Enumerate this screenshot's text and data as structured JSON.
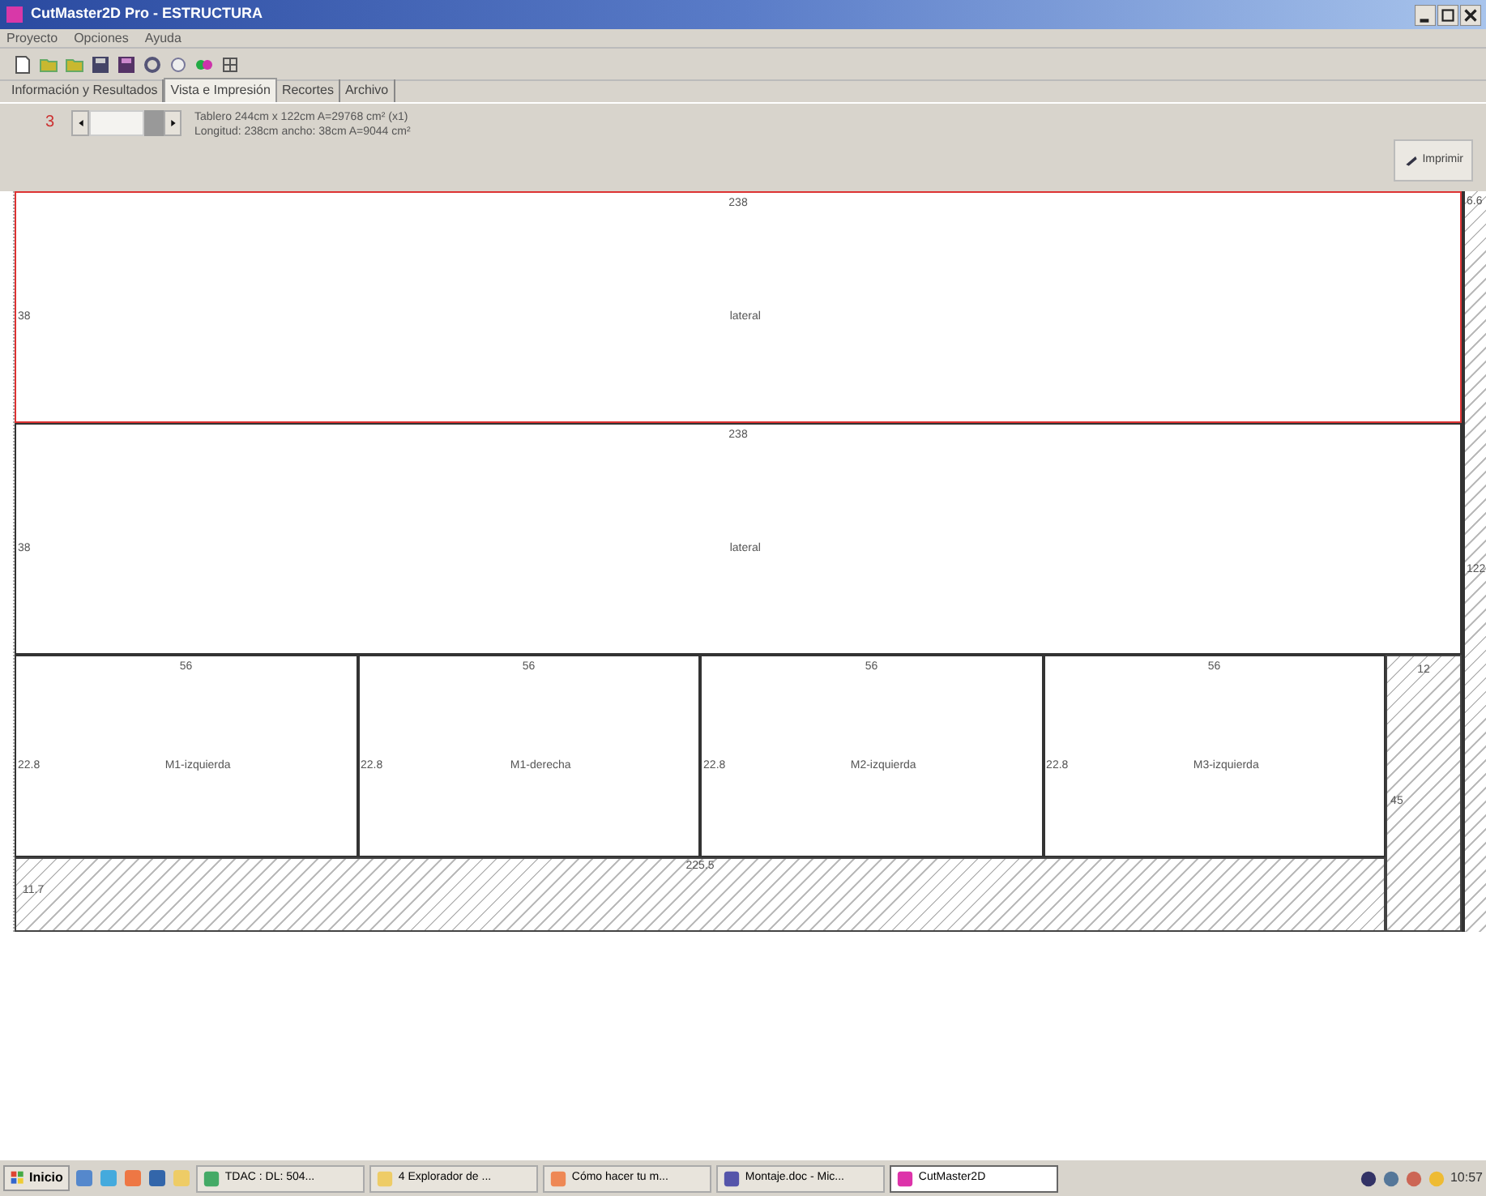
{
  "window": {
    "title": "CutMaster2D Pro - ESTRUCTURA"
  },
  "menu": [
    "Proyecto",
    "Opciones",
    "Ayuda"
  ],
  "tabs": [
    {
      "label": "Información y Resultados",
      "selected": false
    },
    {
      "label": "Vista e Impresión",
      "selected": true
    },
    {
      "label": "Recortes",
      "selected": false
    },
    {
      "label": "Archivo",
      "selected": false
    }
  ],
  "viewer": {
    "page": "3",
    "board_info": "Tablero 244cm x 122cm A=29768 cm² (x1)",
    "piece_info": "Longitud: 238cm ancho: 38cm A=9044 cm²",
    "print_button": "Imprimir"
  },
  "layout": {
    "rows": [
      {
        "pieces": [
          {
            "width_label": "238",
            "height_label": "38",
            "name": "lateral",
            "selected": true
          }
        ]
      },
      {
        "pieces": [
          {
            "width_label": "238",
            "height_label": "38",
            "name": "lateral",
            "selected": false
          }
        ]
      },
      {
        "pieces": [
          {
            "width_label": "56",
            "height_label": "22.8",
            "name": "M1-izquierda",
            "selected": false
          },
          {
            "width_label": "56",
            "height_label": "22.8",
            "name": "M1-derecha",
            "selected": false
          },
          {
            "width_label": "56",
            "height_label": "22.8",
            "name": "M2-izquierda",
            "selected": false
          },
          {
            "width_label": "56",
            "height_label": "22.8",
            "name": "M3-izquierda",
            "selected": false
          }
        ]
      }
    ],
    "bottom_waste": {
      "width_label": "225.5",
      "height_label": "11.7"
    },
    "side_waste": {
      "width_label": "12",
      "height_label": "45"
    },
    "edge_waste": {
      "width_label": "6.6",
      "height_label": "122"
    }
  },
  "taskbar": {
    "start": "Inicio",
    "tasks": [
      {
        "label": "TDAC : DL: 504...",
        "selected": false
      },
      {
        "label": "4 Explorador de ...",
        "selected": false
      },
      {
        "label": "Cómo hacer tu m...",
        "selected": false
      },
      {
        "label": "Montaje.doc - Mic...",
        "selected": false
      },
      {
        "label": "CutMaster2D",
        "selected": true
      }
    ],
    "clock": "10:57"
  }
}
